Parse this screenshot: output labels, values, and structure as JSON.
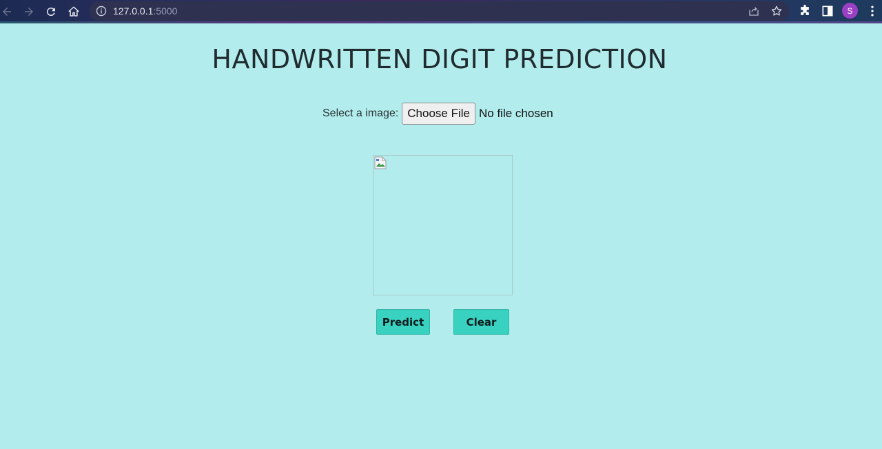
{
  "browser": {
    "url_host": "127.0.0.1",
    "url_port": ":5000",
    "profile_initial": "S",
    "accent_avatar": "#9b3fc4"
  },
  "page": {
    "title": "HANDWRITTEN DIGIT PREDICTION",
    "file_label": "Select a image:",
    "choose_file_label": "Choose File",
    "file_status": "No file chosen",
    "predict_label": "Predict",
    "clear_label": "Clear",
    "background_color": "#b3ecec",
    "button_color": "#39d2c0"
  }
}
